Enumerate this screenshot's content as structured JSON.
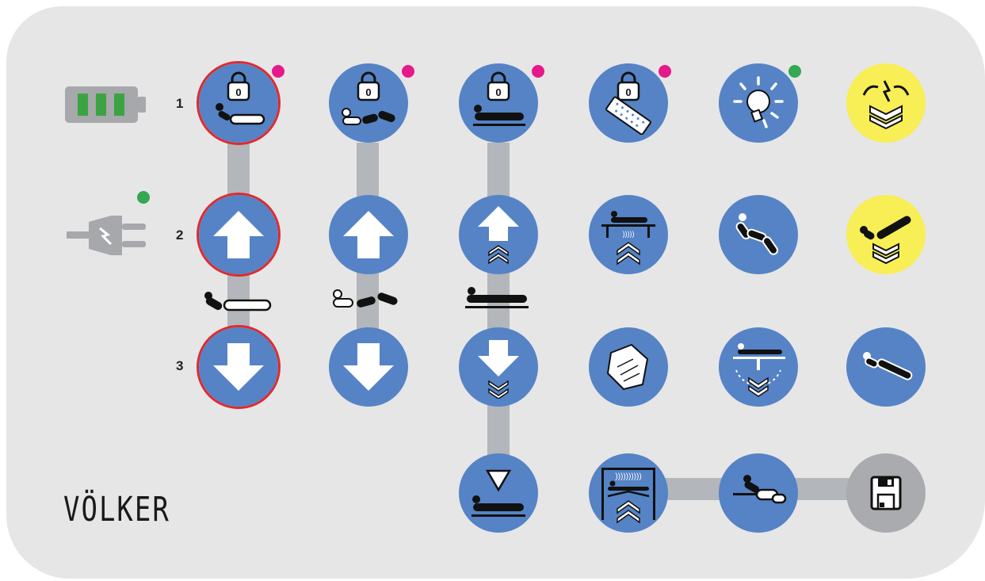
{
  "rows": {
    "r1": "1",
    "r2": "2",
    "r3": "3"
  },
  "brand": {
    "logo": "VÖLKER"
  },
  "colors": {
    "panel": "#e6e6e7",
    "button": "#5583c5",
    "highlight_button": "#f8ee56",
    "save_button": "#a9abae",
    "connector": "#b3b6ba",
    "selection_ring": "#e02a2e",
    "lock_indicator": "#e6198a",
    "status_indicator": "#34a853",
    "battery_bar": "#3ca342"
  },
  "status": {
    "battery_level_bars": 3,
    "power_connected": true,
    "light_on": true
  },
  "locks": {
    "label": "0"
  },
  "buttons": [
    "lock-head-section",
    "lock-leg-sections",
    "lock-height",
    "lock-mattress",
    "light",
    "emergency-trendelenburg",
    "head-up",
    "knee-up",
    "height-up",
    "bed-extension-up",
    "chair-position",
    "cardiac-chair",
    "head-down",
    "knee-down",
    "height-down",
    "cpr",
    "trendelenburg-adjust",
    "reverse-trendelenburg",
    "lowest-position",
    "bed-frame-height",
    "patient-position",
    "save-memory"
  ]
}
